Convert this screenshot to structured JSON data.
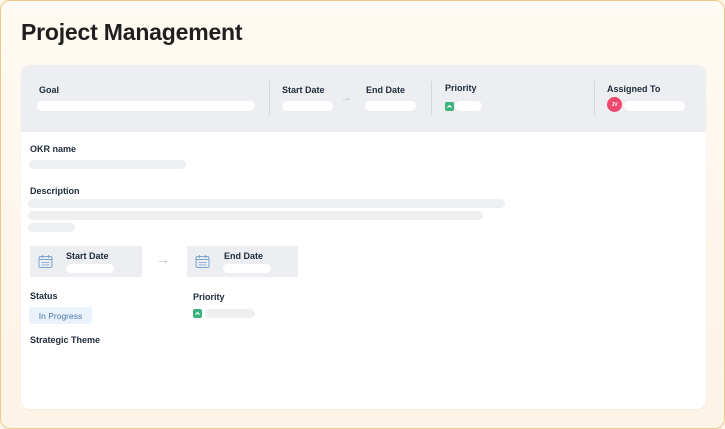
{
  "page": {
    "title": "Project Management"
  },
  "header": {
    "goal_label": "Goal",
    "start_date_label": "Start Date",
    "end_date_label": "End Date",
    "priority_label": "Priority",
    "assigned_to_label": "Assigned To",
    "arrow": "→",
    "avatar_initials": "JV"
  },
  "details": {
    "okr_name_label": "OKR name",
    "description_label": "Description",
    "start_date_label": "Start Date",
    "end_date_label": "End Date",
    "arrow": "→",
    "status_label": "Status",
    "status_value": "In Progress",
    "priority_label": "Priority",
    "strategic_theme_label": "Strategic Theme"
  },
  "colors": {
    "priority_badge": "#3bb37a",
    "avatar": "#f0486d",
    "status_chip_bg": "#eaf3fc",
    "status_chip_text": "#4a78ae"
  },
  "icons": [
    "chevron-up-icon",
    "calendar-icon"
  ]
}
